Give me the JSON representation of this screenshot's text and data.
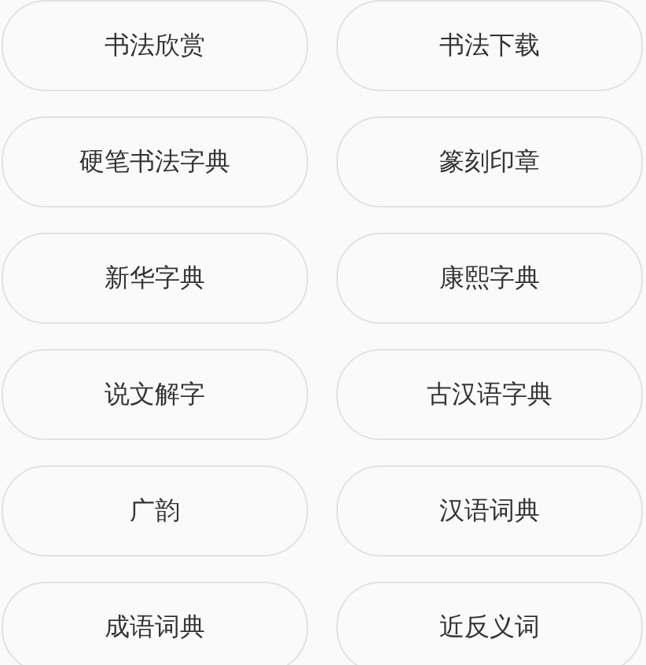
{
  "buttons": [
    {
      "label": "书法欣赏"
    },
    {
      "label": "书法下载"
    },
    {
      "label": "硬笔书法字典"
    },
    {
      "label": "篆刻印章"
    },
    {
      "label": "新华字典"
    },
    {
      "label": "康熙字典"
    },
    {
      "label": "说文解字"
    },
    {
      "label": "古汉语字典"
    },
    {
      "label": "广韵"
    },
    {
      "label": "汉语词典"
    },
    {
      "label": "成语词典"
    },
    {
      "label": "近反义词"
    }
  ]
}
